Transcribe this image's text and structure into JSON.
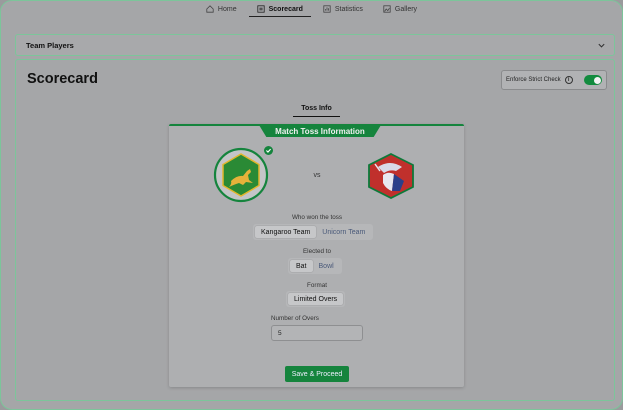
{
  "nav": {
    "tabs": [
      {
        "label": "Home",
        "icon": "home-icon"
      },
      {
        "label": "Scorecard",
        "icon": "scorecard-icon"
      },
      {
        "label": "Statistics",
        "icon": "statistics-icon"
      },
      {
        "label": "Gallery",
        "icon": "gallery-icon"
      }
    ],
    "active": "Scorecard"
  },
  "team_players": {
    "title": "Team Players",
    "icon": "chevron-down-icon"
  },
  "page": {
    "title": "Scorecard"
  },
  "strict_check": {
    "label": "Enforce Strict Check",
    "enabled": true
  },
  "tabs": {
    "toss_info": "Toss Info"
  },
  "toss": {
    "header": "Match Toss Information",
    "vs": "vs",
    "team1_logo": "kangaroo-logo",
    "team2_logo": "unicorn-logo",
    "who_won_label": "Who won the toss",
    "teams": [
      "Kangaroo Team",
      "Unicorn Team"
    ],
    "selected_team": "Kangaroo Team",
    "elected_label": "Elected to",
    "elected_options": [
      "Bat",
      "Bowl"
    ],
    "selected_elected": "Bat",
    "format_label": "Format",
    "format_value": "Limited Overs",
    "overs_label": "Number of Overs",
    "overs_value": "5",
    "save_label": "Save & Proceed"
  },
  "colors": {
    "accent": "#15843d",
    "frame": "#7cc59a"
  }
}
